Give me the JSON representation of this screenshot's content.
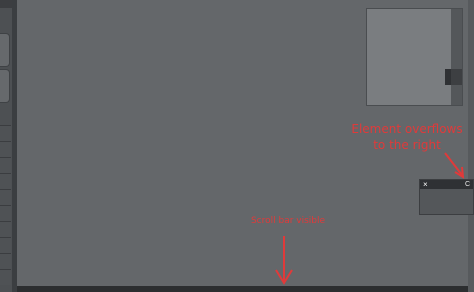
{
  "colors": {
    "canvas": "#64676a",
    "annotation": "#e03a3a"
  },
  "widget": {
    "close_icon": "×",
    "title": "C"
  },
  "annotations": {
    "overflow_line1": "Element overflows",
    "overflow_line2": "to the right",
    "scroll_label": "Scroll bar visible"
  }
}
